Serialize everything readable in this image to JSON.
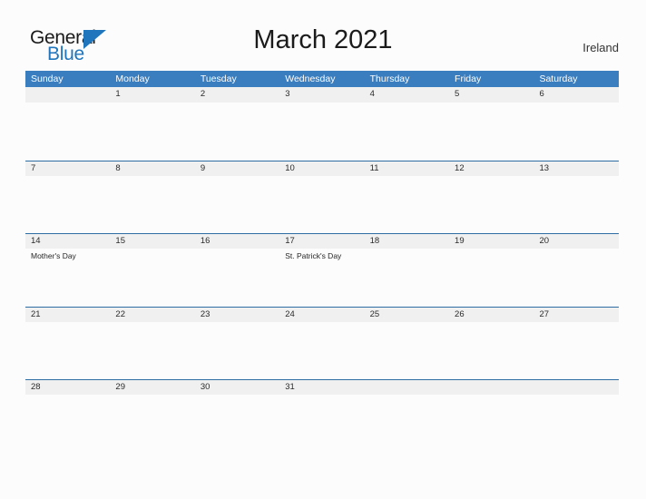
{
  "brand": {
    "name_top": "General",
    "name_bottom": "Blue",
    "accent_color": "#1f76bd"
  },
  "header": {
    "title": "March 2021",
    "country": "Ireland"
  },
  "theme": {
    "header_blue": "#3a7ebf",
    "row_line_blue": "#2d6da3",
    "row_band_gray": "#f0f0f0",
    "page_background": "#fcfcfc"
  },
  "calendar": {
    "weekdays": [
      "Sunday",
      "Monday",
      "Tuesday",
      "Wednesday",
      "Thursday",
      "Friday",
      "Saturday"
    ],
    "weeks": [
      [
        {
          "day": "",
          "event": ""
        },
        {
          "day": "1",
          "event": ""
        },
        {
          "day": "2",
          "event": ""
        },
        {
          "day": "3",
          "event": ""
        },
        {
          "day": "4",
          "event": ""
        },
        {
          "day": "5",
          "event": ""
        },
        {
          "day": "6",
          "event": ""
        }
      ],
      [
        {
          "day": "7",
          "event": ""
        },
        {
          "day": "8",
          "event": ""
        },
        {
          "day": "9",
          "event": ""
        },
        {
          "day": "10",
          "event": ""
        },
        {
          "day": "11",
          "event": ""
        },
        {
          "day": "12",
          "event": ""
        },
        {
          "day": "13",
          "event": ""
        }
      ],
      [
        {
          "day": "14",
          "event": "Mother's Day"
        },
        {
          "day": "15",
          "event": ""
        },
        {
          "day": "16",
          "event": ""
        },
        {
          "day": "17",
          "event": "St. Patrick's Day"
        },
        {
          "day": "18",
          "event": ""
        },
        {
          "day": "19",
          "event": ""
        },
        {
          "day": "20",
          "event": ""
        }
      ],
      [
        {
          "day": "21",
          "event": ""
        },
        {
          "day": "22",
          "event": ""
        },
        {
          "day": "23",
          "event": ""
        },
        {
          "day": "24",
          "event": ""
        },
        {
          "day": "25",
          "event": ""
        },
        {
          "day": "26",
          "event": ""
        },
        {
          "day": "27",
          "event": ""
        }
      ],
      [
        {
          "day": "28",
          "event": ""
        },
        {
          "day": "29",
          "event": ""
        },
        {
          "day": "30",
          "event": ""
        },
        {
          "day": "31",
          "event": ""
        },
        {
          "day": "",
          "event": ""
        },
        {
          "day": "",
          "event": ""
        },
        {
          "day": "",
          "event": ""
        }
      ]
    ]
  }
}
